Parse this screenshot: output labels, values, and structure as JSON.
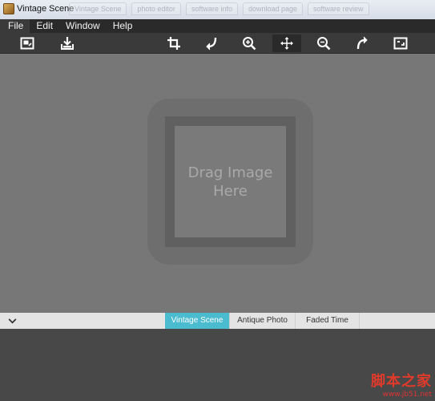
{
  "window": {
    "title": "Vintage Scene",
    "ghost_tabs": [
      "Vintage Scene",
      "photo editor",
      "software info",
      "download page",
      "software review"
    ]
  },
  "menu": {
    "items": [
      "File",
      "Edit",
      "Window",
      "Help"
    ],
    "active_index": 0
  },
  "toolbar": {
    "tools": [
      {
        "name": "open-image-icon",
        "selected": false
      },
      {
        "name": "save-image-icon",
        "selected": false
      },
      {
        "name": "crop-icon",
        "selected": false
      },
      {
        "name": "rotate-left-icon",
        "selected": false
      },
      {
        "name": "zoom-in-icon",
        "selected": false
      },
      {
        "name": "pan-move-icon",
        "selected": true
      },
      {
        "name": "zoom-out-icon",
        "selected": false
      },
      {
        "name": "rotate-right-icon",
        "selected": false
      },
      {
        "name": "fit-screen-icon",
        "selected": false
      }
    ]
  },
  "canvas": {
    "drop_text": "Drag Image Here"
  },
  "filters": {
    "tabs": [
      "Vintage Scene",
      "Antique Photo",
      "Faded Time"
    ],
    "active_index": 0
  },
  "watermark": {
    "text": "脚本之家",
    "url": "www.jb51.net"
  },
  "colors": {
    "accent": "#4bbbd0",
    "canvas": "#777777",
    "toolbar": "#3a3a3a",
    "menubar": "#2a2a2a"
  }
}
